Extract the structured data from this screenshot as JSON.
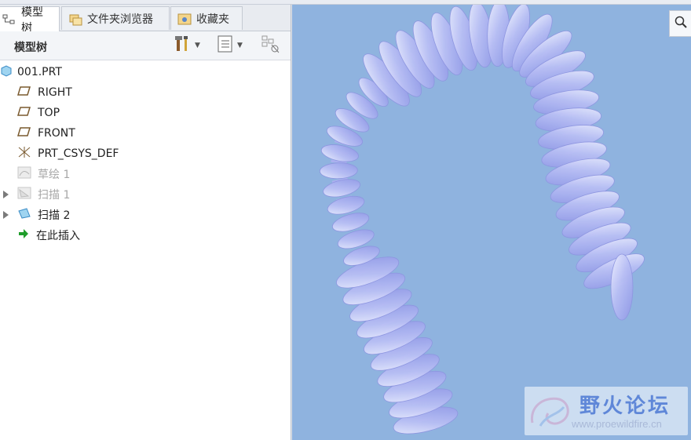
{
  "tabs": [
    {
      "label": "模型树",
      "icon": "model-tree-icon",
      "active": true
    },
    {
      "label": "文件夹浏览器",
      "icon": "folder-browser-icon",
      "active": false
    },
    {
      "label": "收藏夹",
      "icon": "favorites-icon",
      "active": false
    }
  ],
  "toolbar": {
    "title": "模型树",
    "settings_icon": "tools-icon",
    "show_icon": "list-icon",
    "filter_icon": "tree-filter-icon"
  },
  "tree": {
    "root": "001.PRT",
    "items": [
      {
        "label": "RIGHT",
        "icon": "datum-plane-icon"
      },
      {
        "label": "TOP",
        "icon": "datum-plane-icon"
      },
      {
        "label": "FRONT",
        "icon": "datum-plane-icon"
      },
      {
        "label": "PRT_CSYS_DEF",
        "icon": "coordinate-system-icon"
      },
      {
        "label": "草绘 1",
        "icon": "sketch-icon",
        "disabled": true
      },
      {
        "label": "扫描 1",
        "icon": "sweep-icon",
        "disabled": true
      },
      {
        "label": "扫描 2",
        "icon": "sweep-icon"
      },
      {
        "label": "在此插入",
        "icon": "insert-here-arrow-icon"
      }
    ]
  },
  "viewport": {
    "background": "#8fb3df",
    "model_color": "#a7aef0"
  },
  "watermark": {
    "title": "野火论坛",
    "url": "www.proewildfire.cn"
  }
}
